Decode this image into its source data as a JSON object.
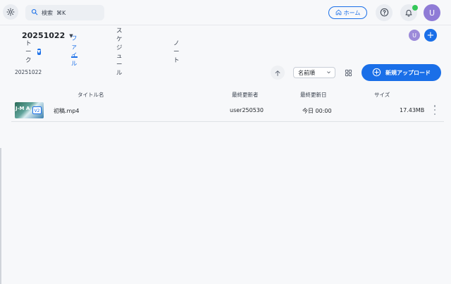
{
  "header": {
    "search_placeholder": "検索",
    "search_shortcut": "⌘K",
    "home_label": "ホーム",
    "avatar_initial": "U"
  },
  "project": {
    "title": "20251022",
    "member_initial": "U",
    "add_member_label": "+"
  },
  "tabs": [
    {
      "label": "トーク"
    },
    {
      "label": "ファイル"
    },
    {
      "label": "スケジュール"
    },
    {
      "label": "ノート"
    }
  ],
  "toolbar": {
    "folder": "20251022",
    "sort_value": "名前順",
    "upload_label": "新規アップロード"
  },
  "table": {
    "columns": [
      "タイトル名",
      "最終更新者",
      "最終更新日",
      "サイズ"
    ],
    "rows": [
      {
        "thumb_text": "J-M A",
        "version": "V2",
        "title": "初稿.mp4",
        "updated_by": "user250530",
        "updated_at": "今日 00:00",
        "size": "17.43MB"
      }
    ]
  },
  "colors": {
    "accent": "#1a6fe8",
    "notification": "#35c759",
    "avatar": "#8f7bd6"
  },
  "icons": [
    "gear-icon",
    "search-icon",
    "home-icon",
    "help-icon",
    "bell-icon",
    "plus-icon",
    "arrow-up-icon",
    "chevron-down-icon",
    "grid-icon",
    "upload-plus-icon",
    "more-vertical-icon"
  ]
}
